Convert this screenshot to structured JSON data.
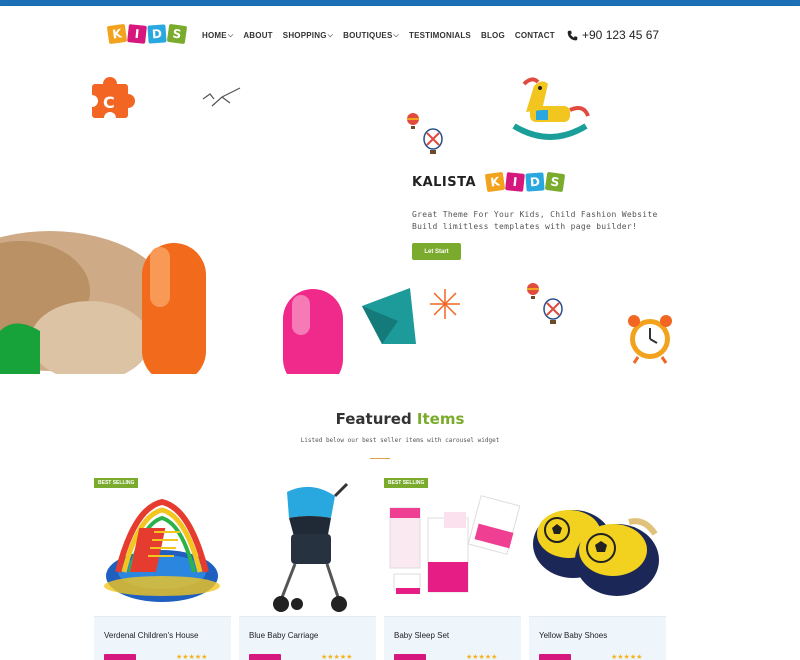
{
  "header": {
    "logo_letters": [
      "K",
      "I",
      "D",
      "S"
    ],
    "logo_colors": [
      "#f2a21c",
      "#d6177d",
      "#29a8df",
      "#7aab2c"
    ],
    "nav": [
      {
        "label": "HOME",
        "dropdown": true
      },
      {
        "label": "ABOUT",
        "dropdown": false
      },
      {
        "label": "SHOPPING",
        "dropdown": true
      },
      {
        "label": "BOUTIQUES",
        "dropdown": true
      },
      {
        "label": "TESTIMONIALS",
        "dropdown": false
      },
      {
        "label": "BLOG",
        "dropdown": false
      },
      {
        "label": "CONTACT",
        "dropdown": false
      }
    ],
    "phone_icon": "phone-icon",
    "phone": "+90 123 45 67"
  },
  "hero": {
    "brand_word": "KALISTA",
    "brand_kids_letters": [
      "K",
      "I",
      "D",
      "S"
    ],
    "tagline_line1": "Great Theme For Your Kids, Child Fashion Website",
    "tagline_line2": "Build limitless templates with page builder!",
    "button_label": "Let Start"
  },
  "featured": {
    "title_plain": "Featured",
    "title_highlight": "Items",
    "subtitle": "Listed below our best seller items with carousel widget",
    "accent_color": "#7aab2c",
    "price_color": "#d6177d",
    "products": [
      {
        "name": "Verdenal Children's House",
        "badge": "BEST SELLING",
        "rating": 5
      },
      {
        "name": "Blue Baby Carriage",
        "badge": "",
        "rating": 5
      },
      {
        "name": "Baby Sleep Set",
        "badge": "BEST SELLING",
        "rating": 5
      },
      {
        "name": "Yellow Baby Shoes",
        "badge": "",
        "rating": 5
      }
    ]
  }
}
